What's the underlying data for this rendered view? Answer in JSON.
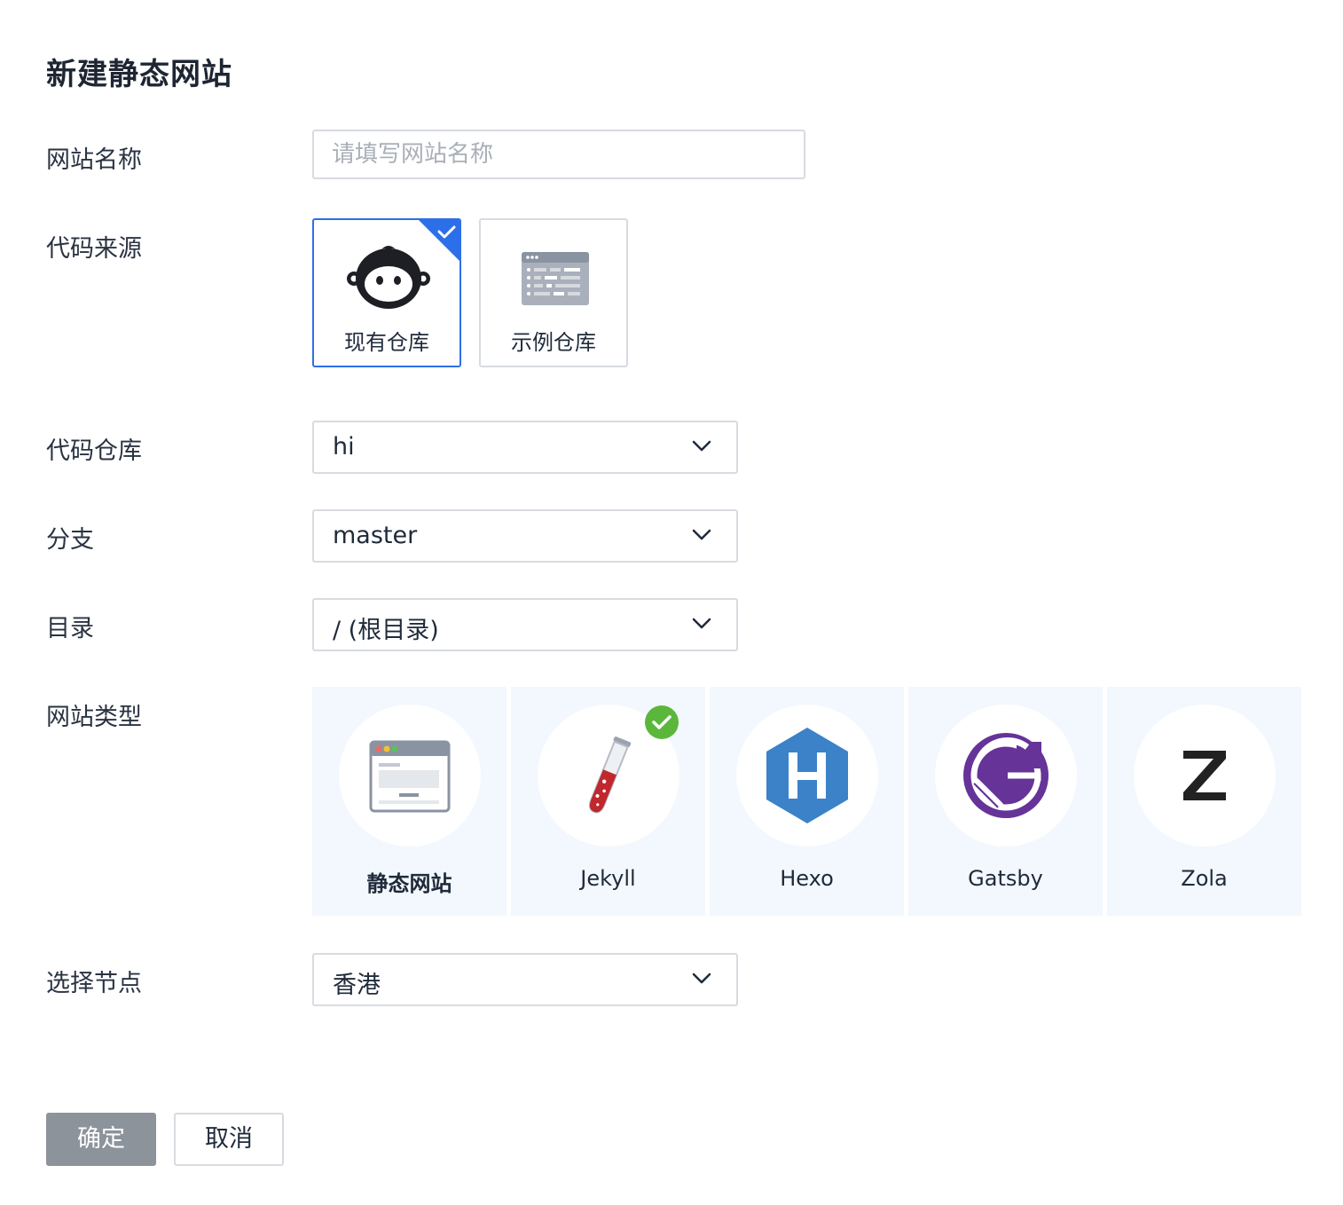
{
  "page_title": "新建静态网站",
  "labels": {
    "site_name": "网站名称",
    "code_source": "代码来源",
    "repo": "代码仓库",
    "branch": "分支",
    "directory": "目录",
    "site_type": "网站类型",
    "node": "选择节点"
  },
  "site_name_input": {
    "placeholder": "请填写网站名称",
    "value": ""
  },
  "code_sources": [
    {
      "label": "现有仓库",
      "icon": "monkey-icon",
      "selected": true
    },
    {
      "label": "示例仓库",
      "icon": "template-list-icon",
      "selected": false
    }
  ],
  "repo_select": {
    "value": "hi"
  },
  "branch_select": {
    "value": "master"
  },
  "directory_select": {
    "value": "/ (根目录)"
  },
  "site_types": [
    {
      "label": "静态网站",
      "icon": "browser-window-icon",
      "selected": false
    },
    {
      "label": "Jekyll",
      "icon": "test-tube-icon",
      "selected": true
    },
    {
      "label": "Hexo",
      "icon": "hexagon-h-icon",
      "selected": false
    },
    {
      "label": "Gatsby",
      "icon": "gatsby-g-icon",
      "selected": false
    },
    {
      "label": "Zola",
      "icon": "z-icon",
      "selected": false
    }
  ],
  "node_select": {
    "value": "香港"
  },
  "buttons": {
    "confirm": "确定",
    "cancel": "取消"
  },
  "colors": {
    "accent": "#2d6fe8",
    "success": "#5bb73c",
    "card_bg": "#f2f8fd",
    "primary_button": "#8d939b",
    "hexo_blue": "#3b82c8",
    "gatsby_purple": "#663399"
  }
}
